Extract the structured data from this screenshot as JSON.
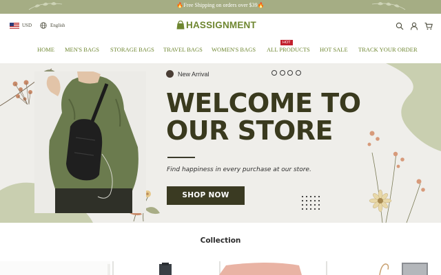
{
  "announcement": {
    "text": "🔥Free Shipping on orders over $39🔥"
  },
  "header": {
    "currency": "USD",
    "language": "English",
    "logo_text": "HASSIGNMENT",
    "icons": [
      "search-icon",
      "account-icon",
      "cart-icon"
    ]
  },
  "nav": {
    "items": [
      {
        "label": "HOME"
      },
      {
        "label": "MEN'S BAGS"
      },
      {
        "label": "STORAGE BAGS"
      },
      {
        "label": "TRAVEL BAGS"
      },
      {
        "label": "WOMEN'S BAGS"
      },
      {
        "label": "ALL PRODUCTS"
      },
      {
        "label": "HOT SALE"
      },
      {
        "label": "TRACK YOUR ORDER"
      }
    ],
    "hot_badge": "HOT"
  },
  "hero": {
    "eyebrow": "New Arrival",
    "headline_line1": "WELCOME TO",
    "headline_line2": "OUR STORE",
    "tagline": "Find happiness in every purchase at our store.",
    "cta": "SHOP NOW",
    "slide_count": 4
  },
  "collection": {
    "title": "Collection"
  },
  "colors": {
    "brand_green": "#6e8630",
    "announcement_bg": "#a5ad84",
    "hot_red": "#c2202d",
    "cta_bg": "#3a3a22",
    "hero_bg": "#efeeea"
  }
}
